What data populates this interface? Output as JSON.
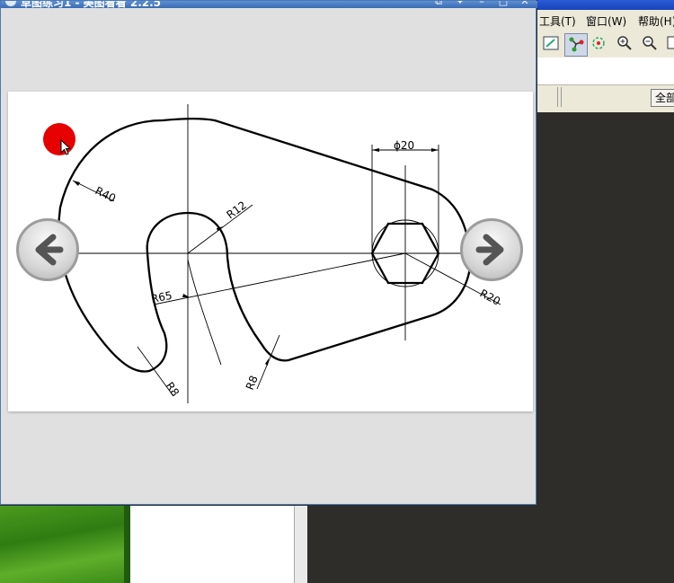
{
  "background_app": {
    "menu": [
      "工具(T)",
      "窗口(W)",
      "帮助(H)"
    ],
    "full_button_label": "全部"
  },
  "viewer_window": {
    "title": "草图练习1 - 美图看看 2.2.5"
  },
  "drawing": {
    "dim_diameter": "ϕ20",
    "dim_r40": "R40",
    "dim_r12": "R12",
    "dim_r65": "R65",
    "dim_r20": "R20",
    "dim_r8_left": "R8",
    "dim_r8_right": "R8"
  },
  "colors": {
    "window_border": "#4a79b8",
    "marker_red": "#e60000",
    "desktop_dark": "#2f2d29"
  },
  "icons": [
    "prev-arrow-icon",
    "next-arrow-icon",
    "mouse-cursor-icon",
    "zoom-in-icon",
    "zoom-out-icon"
  ]
}
